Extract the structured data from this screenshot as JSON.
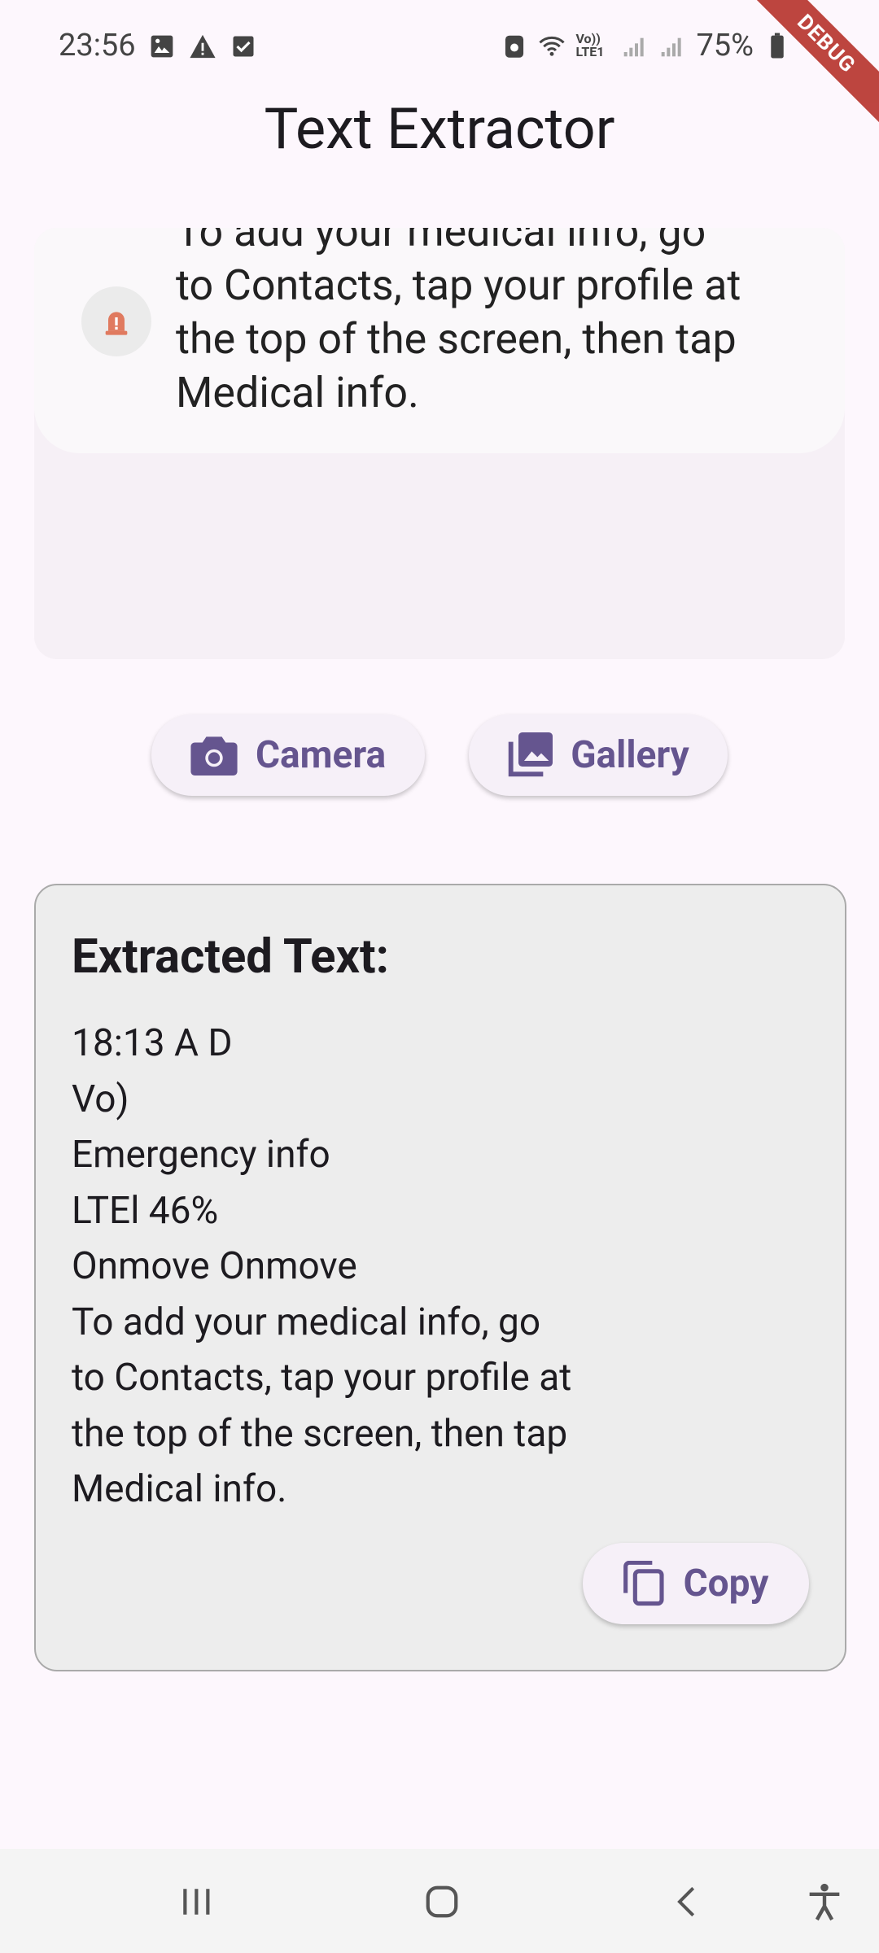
{
  "status_bar": {
    "time": "23:56",
    "network": "Vo)) LTE1",
    "battery": "75%",
    "icons": [
      "image-icon",
      "warning-icon",
      "checkbox-icon",
      "android-icon",
      "wifi-icon",
      "signal-icon",
      "battery-icon"
    ]
  },
  "debug_banner": "DEBUG",
  "app_bar": {
    "title": "Text Extractor"
  },
  "preview": {
    "notice_lines": [
      "To add your medical info, go",
      "to Contacts, tap your profile at",
      "the top of the screen, then tap",
      "Medical info."
    ],
    "notice_icon": "siren-icon"
  },
  "actions": {
    "camera_label": "Camera",
    "gallery_label": "Gallery"
  },
  "result": {
    "heading": "Extracted Text:",
    "lines": [
      "18:13 A D",
      "Vo)",
      "Emergency info",
      "LTEl 46%",
      "Onmove Onmove",
      "To add your medical info, go",
      "to Contacts, tap your profile at",
      "the top of the screen, then tap",
      "Medical info."
    ],
    "copy_label": "Copy"
  },
  "colors": {
    "accent": "#65558f",
    "background": "#fdf7fd",
    "siren": "#e07a5f",
    "debug": "#b3261e"
  },
  "nav": [
    "recent-apps-icon",
    "home-icon",
    "back-icon",
    "accessibility-icon"
  ]
}
